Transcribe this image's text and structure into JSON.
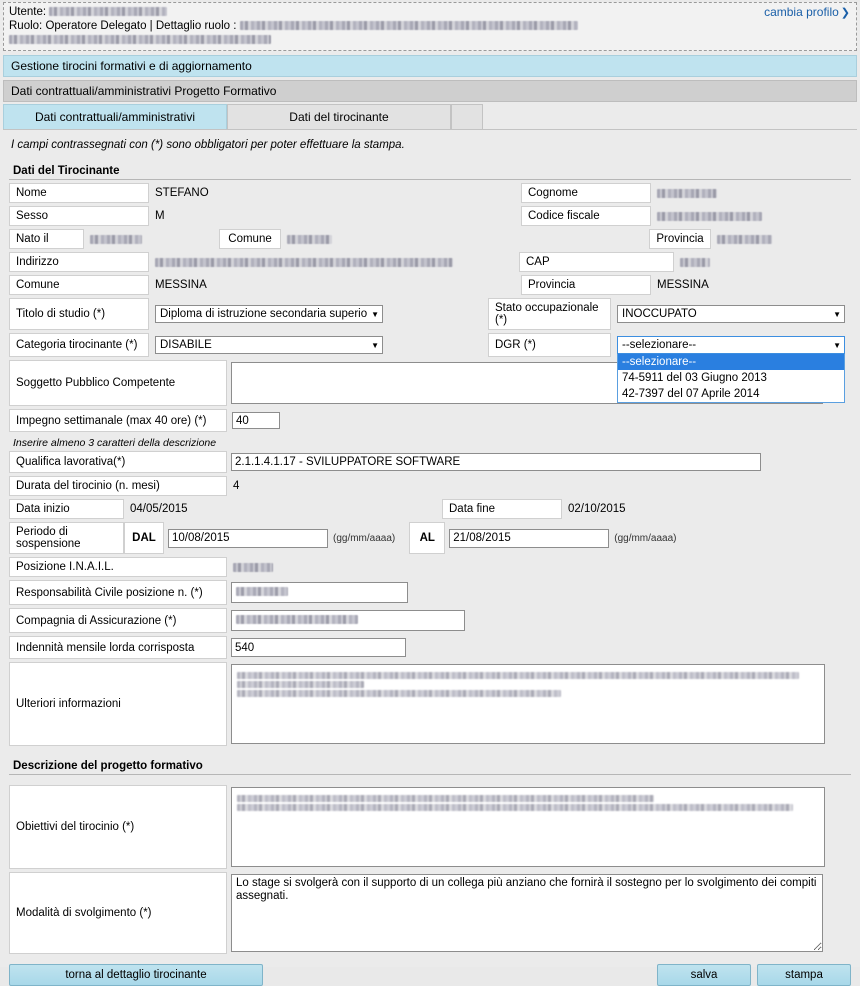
{
  "header": {
    "user_label": "Utente:",
    "user_value_redacted": true,
    "role_label": "Ruolo:",
    "role_value": "Operatore Delegato",
    "role_separator": "|",
    "role_detail_label": "Dettaglio ruolo :",
    "role_detail_redacted": true,
    "change_profile_link": "cambia profilo",
    "change_profile_icon": "chevron-right-icon"
  },
  "banner": {
    "title": "Gestione tirocini formativi e di aggiornamento",
    "subtitle": "Dati contrattuali/amministrativi Progetto Formativo",
    "color": "#bfe3ef"
  },
  "tabs": [
    {
      "label": "Dati contrattuali/amministrativi",
      "active": true
    },
    {
      "label": "Dati del tirocinante",
      "active": false
    }
  ],
  "required_note": "I campi contrassegnati con (*) sono obbligatori per poter effettuare la stampa.",
  "sections": {
    "trainee": {
      "title": "Dati del Tirocinante"
    },
    "project": {
      "title": "Descrizione del progetto formativo"
    }
  },
  "fields": {
    "nome": {
      "label": "Nome",
      "value": "STEFANO"
    },
    "cognome": {
      "label": "Cognome",
      "value": "",
      "redacted": true
    },
    "sesso": {
      "label": "Sesso",
      "value": "M"
    },
    "codice_fiscale": {
      "label": "Codice fiscale",
      "value": "",
      "redacted": true
    },
    "nato_il": {
      "label": "Nato il",
      "value": "",
      "redacted": true
    },
    "comune_nascita": {
      "label": "Comune",
      "value": "",
      "redacted": true
    },
    "provincia_nascita": {
      "label": "Provincia",
      "value": "",
      "redacted": true
    },
    "indirizzo": {
      "label": "Indirizzo",
      "value": "",
      "redacted": true
    },
    "cap": {
      "label": "CAP",
      "value": "",
      "redacted": true
    },
    "comune": {
      "label": "Comune",
      "value": "MESSINA"
    },
    "provincia": {
      "label": "Provincia",
      "value": "MESSINA"
    },
    "titolo_di_studio": {
      "label": "Titolo di studio (*)",
      "value": "Diploma di istruzione secondaria superio"
    },
    "stato_occupazionale": {
      "label": "Stato occupazionale (*)",
      "value": "INOCCUPATO"
    },
    "categoria_tirocinante": {
      "label": "Categoria tirocinante (*)",
      "value": "DISABILE"
    },
    "dgr": {
      "label": "DGR (*)",
      "value": "--selezionare--",
      "open": true,
      "options": [
        "--selezionare--",
        "74-5911 del 03 Giugno 2013",
        "42-7397 del 07 Aprile 2014"
      ],
      "selected_index": 0
    },
    "soggetto_pubblico": {
      "label": "Soggetto Pubblico Competente",
      "value": ""
    },
    "impegno_settimanale": {
      "label": "Impegno settimanale (max 40 ore) (*)",
      "value": "40"
    },
    "qualifica_hint": "Inserire almeno 3 caratteri della descrizione",
    "qualifica": {
      "label": "Qualifica lavorativa(*)",
      "value": "2.1.1.4.1.17 - SVILUPPATORE SOFTWARE"
    },
    "durata": {
      "label": "Durata del tirocinio (n. mesi)",
      "value": "4"
    },
    "data_inizio": {
      "label": "Data inizio",
      "value": "04/05/2015"
    },
    "data_fine": {
      "label": "Data fine",
      "value": "02/10/2015"
    },
    "periodo_sospensione": {
      "label": "Periodo di sospensione",
      "from_label": "DAL",
      "from_value": "10/08/2015",
      "from_format": "(gg/mm/aaaa)",
      "to_label": "AL",
      "to_value": "21/08/2015",
      "to_format": "(gg/mm/aaaa)"
    },
    "posizione_inail": {
      "label": "Posizione I.N.A.I.L.",
      "value": "",
      "redacted": true
    },
    "responsabilita_civile": {
      "label": "Responsabilità Civile posizione n. (*)",
      "value": "",
      "redacted": true
    },
    "compagnia_assicurazione": {
      "label": "Compagnia di Assicurazione (*)",
      "value": "",
      "redacted": true
    },
    "indennita": {
      "label": "Indennità mensile lorda corrisposta",
      "value": "540"
    },
    "ulteriori_informazioni": {
      "label": "Ulteriori informazioni",
      "value": "",
      "redacted": true,
      "redacted_lines": 3
    },
    "obiettivi": {
      "label": "Obiettivi del tirocinio (*)",
      "value": "",
      "redacted": true,
      "redacted_lines": 2
    },
    "modalita": {
      "label": "Modalità di svolgimento (*)",
      "value": "Lo stage si svolgerà con il supporto di un collega più anziano che fornirà il sostegno per lo svolgimento dei compiti assegnati."
    }
  },
  "buttons": {
    "back": "torna al dettaglio tirocinante",
    "save": "salva",
    "print": "stampa"
  }
}
